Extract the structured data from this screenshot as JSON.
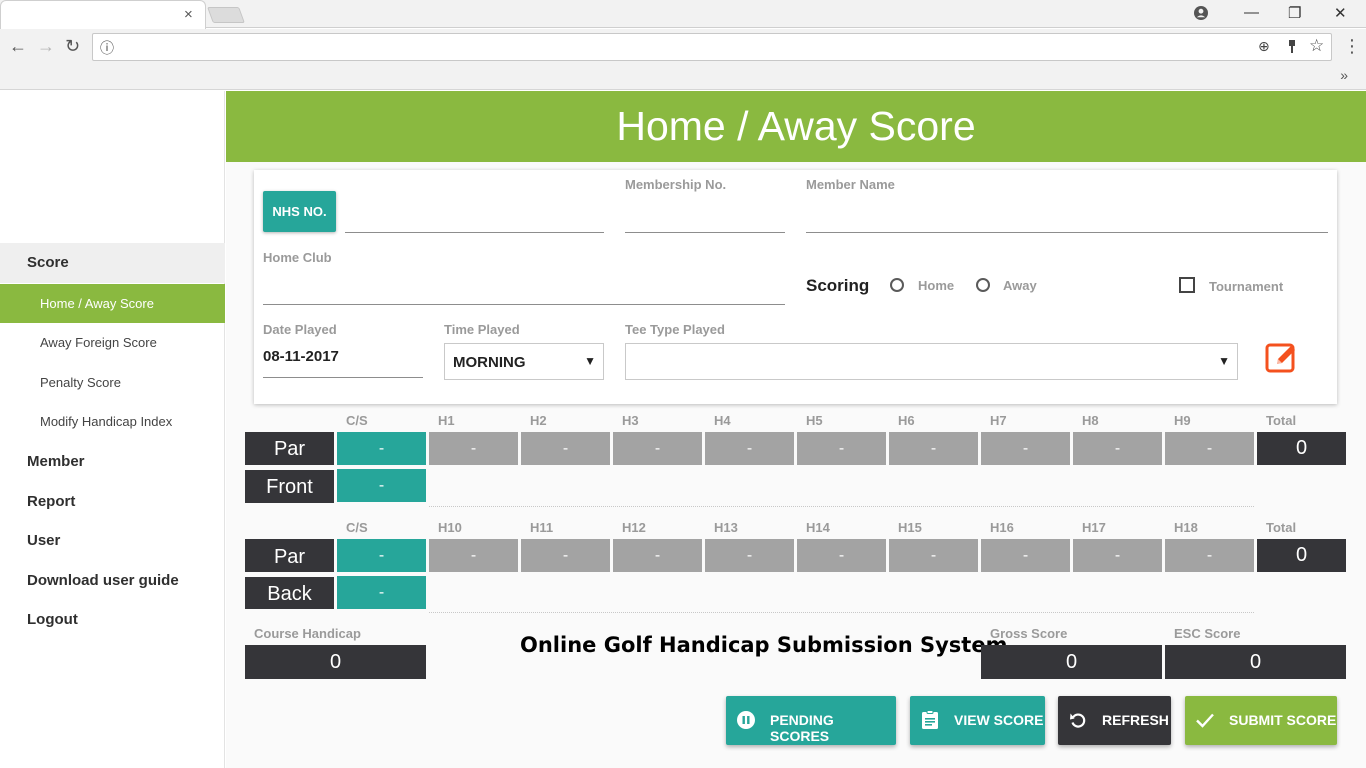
{
  "browser": {
    "win_controls": {
      "minimize": "—",
      "restore": "❐",
      "close": "✕"
    },
    "nav": {
      "back": "←",
      "forward": "→",
      "reload": "↻"
    },
    "address": {
      "info_glyph": "ⓘ",
      "zoom_glyph": "⊕",
      "star_glyph": "☆",
      "menu_glyph": "⋮",
      "url": ""
    },
    "bookmarks_overflow": "»",
    "tab_close": "×"
  },
  "sidebar": {
    "groups": [
      {
        "label": "Score",
        "active": true
      },
      {
        "label": "Member"
      },
      {
        "label": "Report"
      },
      {
        "label": "User"
      },
      {
        "label": "Download user guide"
      },
      {
        "label": "Logout"
      }
    ],
    "score_items": [
      {
        "label": "Home / Away Score",
        "active": true
      },
      {
        "label": "Away Foreign Score"
      },
      {
        "label": "Penalty Score"
      },
      {
        "label": "Modify Handicap Index"
      }
    ]
  },
  "header": {
    "title": "Home / Away Score"
  },
  "form": {
    "nhs_button": "NHS NO.",
    "nhs_value": "",
    "membership_label": "Membership No.",
    "membership_value": "",
    "member_name_label": "Member Name",
    "member_name_value": "",
    "home_club_label": "Home Club",
    "home_club_value": "",
    "scoring_label": "Scoring",
    "radio_home": "Home",
    "radio_away": "Away",
    "tournament_label": "Tournament",
    "date_label": "Date Played",
    "date_value": "08-11-2017",
    "time_label": "Time Played",
    "time_value": "MORNING",
    "tee_label": "Tee Type Played",
    "tee_value": "",
    "select_arrow": "▼"
  },
  "front": {
    "cs_header": "C/S",
    "hole_headers": [
      "H1",
      "H2",
      "H3",
      "H4",
      "H5",
      "H6",
      "H7",
      "H8",
      "H9"
    ],
    "total_header": "Total",
    "par_label": "Par",
    "row_label": "Front",
    "par_cs": "-",
    "par_values": [
      "-",
      "-",
      "-",
      "-",
      "-",
      "-",
      "-",
      "-",
      "-"
    ],
    "total": "0",
    "front_cs": "-"
  },
  "back": {
    "cs_header": "C/S",
    "hole_headers": [
      "H10",
      "H11",
      "H12",
      "H13",
      "H14",
      "H15",
      "H16",
      "H17",
      "H18"
    ],
    "total_header": "Total",
    "par_label": "Par",
    "row_label": "Back",
    "par_cs": "-",
    "par_values": [
      "-",
      "-",
      "-",
      "-",
      "-",
      "-",
      "-",
      "-",
      "-"
    ],
    "total": "0",
    "back_cs": "-"
  },
  "summary": {
    "course_handicap_label": "Course Handicap",
    "course_handicap": "0",
    "system_title": "Online Golf Handicap Submission System",
    "gross_label": "Gross Score",
    "gross": "0",
    "esc_label": "ESC Score",
    "esc": "0"
  },
  "actions": {
    "pending": "PENDING SCORES",
    "view": "VIEW SCORE",
    "refresh": "REFRESH",
    "submit": "SUBMIT SCORE"
  },
  "colors": {
    "accent_green": "#8ab940",
    "teal": "#26a69a",
    "dark": "#353539",
    "grey_cell": "#a3a3a3",
    "edit_icon": "#f4511e"
  }
}
